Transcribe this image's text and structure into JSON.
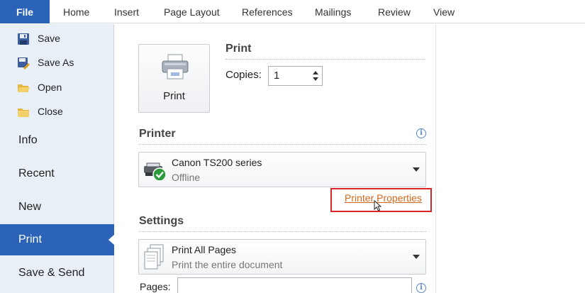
{
  "ribbon": {
    "tabs": [
      "File",
      "Home",
      "Insert",
      "Page Layout",
      "References",
      "Mailings",
      "Review",
      "View"
    ]
  },
  "nav": {
    "small_items": [
      {
        "label": "Save",
        "icon": "save-icon"
      },
      {
        "label": "Save As",
        "icon": "save-as-icon"
      },
      {
        "label": "Open",
        "icon": "open-folder-icon"
      },
      {
        "label": "Close",
        "icon": "close-folder-icon"
      }
    ],
    "big_items": [
      "Info",
      "Recent",
      "New",
      "Print",
      "Save & Send"
    ],
    "active": "Print"
  },
  "print_section": {
    "heading": "Print",
    "button_label": "Print",
    "copies_label": "Copies:",
    "copies_value": "1"
  },
  "printer_section": {
    "heading": "Printer",
    "name": "Canon TS200 series",
    "status": "Offline",
    "properties_link": "Printer Properties"
  },
  "settings_section": {
    "heading": "Settings",
    "option_title": "Print All Pages",
    "option_sub": "Print the entire document",
    "pages_label": "Pages:",
    "pages_value": ""
  },
  "colors": {
    "accent": "#2a63b8",
    "nav_bg": "#e9eff7",
    "link": "#d2671c",
    "highlight": "#d9262c"
  }
}
